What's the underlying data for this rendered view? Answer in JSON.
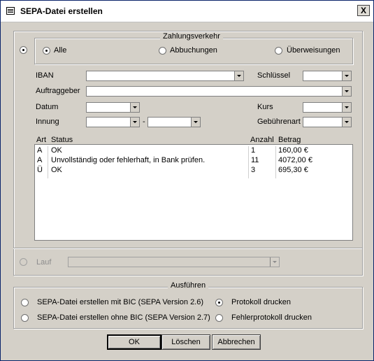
{
  "window": {
    "title": "SEPA-Datei erstellen",
    "close_label": "X"
  },
  "zahlungsverkehr": {
    "legend": "Zahlungsverkehr",
    "options": [
      "Alle",
      "Abbuchungen",
      "Überweisungen"
    ],
    "selected": "Alle"
  },
  "form": {
    "iban_label": "IBAN",
    "schluessel_label": "Schlüssel",
    "auftraggeber_label": "Auftraggeber",
    "datum_label": "Datum",
    "kurs_label": "Kurs",
    "innung_label": "Innung",
    "innung_separator": "-",
    "gebuehrenart_label": "Gebührenart"
  },
  "table": {
    "columns": [
      "Art",
      "Status",
      "Anzahl",
      "Betrag"
    ],
    "rows": [
      [
        "A",
        "OK",
        "1",
        "160,00 €"
      ],
      [
        "A",
        "Unvollständig oder fehlerhaft, in Bank prüfen.",
        "11",
        "4072,00 €"
      ],
      [
        "Ü",
        "OK",
        "3",
        "695,30 €"
      ]
    ]
  },
  "lauf": {
    "label": "Lauf"
  },
  "ausfuehren": {
    "legend": "Ausführen",
    "mit_bic": "SEPA-Datei erstellen mit BIC  (SEPA Version 2.6)",
    "ohne_bic": "SEPA-Datei erstellen ohne BIC  (SEPA Version 2.7)",
    "protokoll": "Protokoll drucken",
    "fehlerprotokoll": "Fehlerprotokoll drucken"
  },
  "buttons": {
    "ok": "OK",
    "loeschen": "Löschen",
    "abbrechen": "Abbrechen"
  }
}
